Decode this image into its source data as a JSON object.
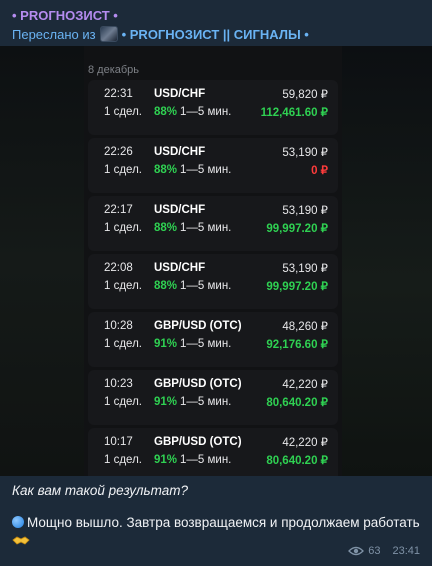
{
  "message": {
    "sender": "• PROГНОЗИСТ •",
    "forwarded_prefix": "Переслано из",
    "forwarded_channel": "• PROГНОЗИСТ || СИГНАЛЫ •",
    "caption_question": "Как вам такой результат?",
    "caption_answer": "Мощно вышло. Завтра возвращаемся и продолжаем работать",
    "views": "63",
    "time": "23:41"
  },
  "screenshot": {
    "date_header": "8 декабрь",
    "trades": [
      {
        "time": "22:31",
        "pair": "USD/CHF",
        "amount": "59,820 ₽",
        "deals": "1 сдел.",
        "pct": "88%",
        "duration": "1—5 мин.",
        "profit": "112,461.60 ₽",
        "loss": false
      },
      {
        "time": "22:26",
        "pair": "USD/CHF",
        "amount": "53,190 ₽",
        "deals": "1 сдел.",
        "pct": "88%",
        "duration": "1—5 мин.",
        "profit": "0 ₽",
        "loss": true
      },
      {
        "time": "22:17",
        "pair": "USD/CHF",
        "amount": "53,190 ₽",
        "deals": "1 сдел.",
        "pct": "88%",
        "duration": "1—5 мин.",
        "profit": "99,997.20 ₽",
        "loss": false
      },
      {
        "time": "22:08",
        "pair": "USD/CHF",
        "amount": "53,190 ₽",
        "deals": "1 сдел.",
        "pct": "88%",
        "duration": "1—5 мин.",
        "profit": "99,997.20 ₽",
        "loss": false
      },
      {
        "time": "10:28",
        "pair": "GBP/USD (OTC)",
        "amount": "48,260 ₽",
        "deals": "1 сдел.",
        "pct": "91%",
        "duration": "1—5 мин.",
        "profit": "92,176.60 ₽",
        "loss": false
      },
      {
        "time": "10:23",
        "pair": "GBP/USD (OTC)",
        "amount": "42,220 ₽",
        "deals": "1 сдел.",
        "pct": "91%",
        "duration": "1—5 мин.",
        "profit": "80,640.20 ₽",
        "loss": false
      },
      {
        "time": "10:17",
        "pair": "GBP/USD (OTC)",
        "amount": "42,220 ₽",
        "deals": "1 сдел.",
        "pct": "91%",
        "duration": "1—5 мин.",
        "profit": "80,640.20 ₽",
        "loss": false
      }
    ]
  },
  "colors": {
    "profit": "#2fd152",
    "loss": "#ff3b3b",
    "sender": "#b58cf0",
    "link": "#6ab3f3"
  },
  "icons": [
    "channel-avatar-icon",
    "blue-dot-icon",
    "handshake-icon",
    "eye-icon"
  ]
}
